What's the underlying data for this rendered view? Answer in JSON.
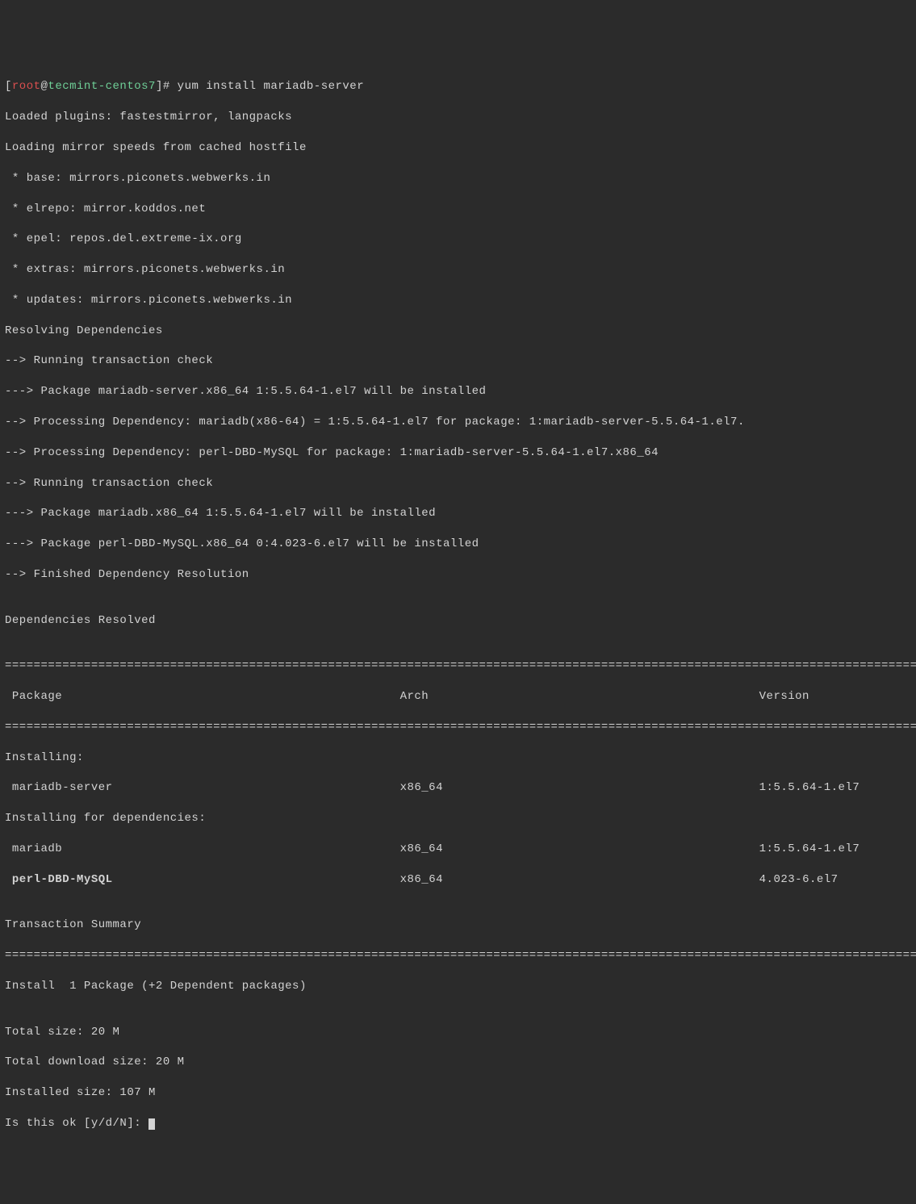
{
  "prompt": {
    "open": "[",
    "user": "root",
    "at": "@",
    "host": "tecmint-centos7",
    "close": "]# "
  },
  "command": "yum install mariadb-server",
  "lines": {
    "l1": "Loaded plugins: fastestmirror, langpacks",
    "l2": "Loading mirror speeds from cached hostfile",
    "l3": " * base: mirrors.piconets.webwerks.in",
    "l4": " * elrepo: mirror.koddos.net",
    "l5": " * epel: repos.del.extreme-ix.org",
    "l6": " * extras: mirrors.piconets.webwerks.in",
    "l7": " * updates: mirrors.piconets.webwerks.in",
    "l8": "Resolving Dependencies",
    "l9": "--> Running transaction check",
    "l10": "---> Package mariadb-server.x86_64 1:5.5.64-1.el7 will be installed",
    "l11": "--> Processing Dependency: mariadb(x86-64) = 1:5.5.64-1.el7 for package: 1:mariadb-server-5.5.64-1.el7.",
    "l12": "--> Processing Dependency: perl-DBD-MySQL for package: 1:mariadb-server-5.5.64-1.el7.x86_64",
    "l13": "--> Running transaction check",
    "l14": "---> Package mariadb.x86_64 1:5.5.64-1.el7 will be installed",
    "l15": "---> Package perl-DBD-MySQL.x86_64 0:4.023-6.el7 will be installed",
    "l16": "--> Finished Dependency Resolution",
    "l17": "",
    "l18": "Dependencies Resolved",
    "l19": "",
    "sep1": "================================================================================================================================",
    "header": " Package                                               Arch                                              Version",
    "sep2": "================================================================================================================================",
    "inst": "Installing:",
    "pkg1": " mariadb-server                                        x86_64                                            1:5.5.64-1.el7",
    "instdep": "Installing for dependencies:",
    "pkg2": " mariadb                                               x86_64                                            1:5.5.64-1.el7",
    "pkg3_name": " perl-DBD-MySQL",
    "pkg3_rest": "                                        x86_64                                            4.023-6.el7",
    "l20": "",
    "l21": "Transaction Summary",
    "sep3": "================================================================================================================================",
    "l22": "Install  1 Package (+2 Dependent packages)",
    "l23": "",
    "l24": "Total size: 20 M",
    "l25": "Total download size: 20 M",
    "l26": "Installed size: 107 M",
    "l27": "Is this ok [y/d/N]: "
  }
}
